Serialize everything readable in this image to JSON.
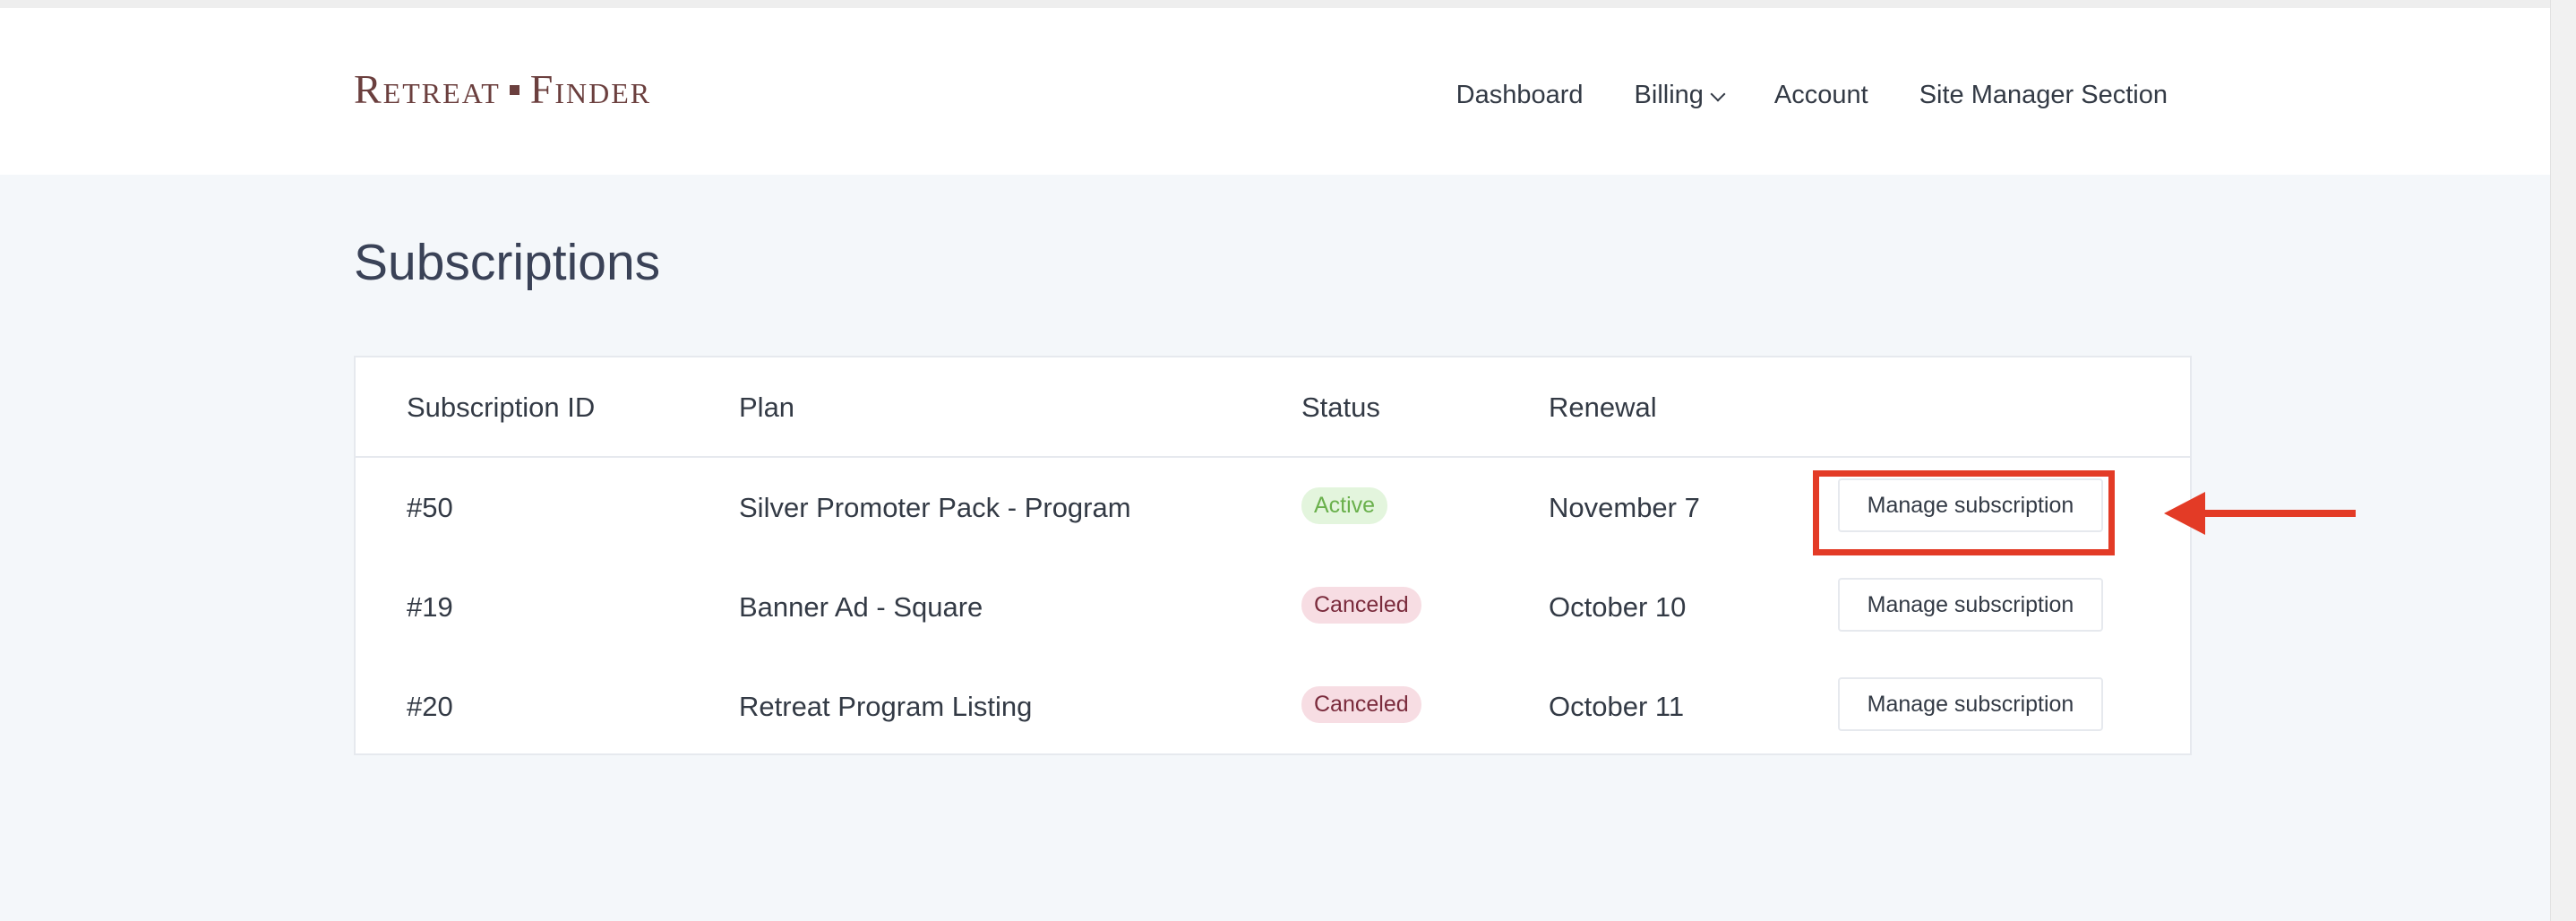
{
  "brand": {
    "logo_left": "Retreat",
    "logo_right": "Finder"
  },
  "nav": {
    "items": [
      {
        "label": "Dashboard"
      },
      {
        "label": "Billing"
      },
      {
        "label": "Account"
      },
      {
        "label": "Site Manager Section"
      }
    ]
  },
  "page": {
    "title": "Subscriptions"
  },
  "table": {
    "headers": {
      "id": "Subscription ID",
      "plan": "Plan",
      "status": "Status",
      "renewal": "Renewal"
    },
    "rows": [
      {
        "id": "#50",
        "plan": "Silver Promoter Pack - Program",
        "status": "Active",
        "renewal": "November 7",
        "action": "Manage subscription"
      },
      {
        "id": "#19",
        "plan": "Banner Ad - Square",
        "status": "Canceled",
        "renewal": "October 10",
        "action": "Manage subscription"
      },
      {
        "id": "#20",
        "plan": "Retreat Program Listing",
        "status": "Canceled",
        "renewal": "October 11",
        "action": "Manage subscription"
      }
    ]
  },
  "colors": {
    "brand": "#6b3f3e",
    "annotation": "#e33b26",
    "active_badge_bg": "#e3f5dd",
    "active_badge_text": "#6ab04c",
    "canceled_badge_bg": "#f7dde3",
    "canceled_badge_text": "#7a2b3c"
  }
}
